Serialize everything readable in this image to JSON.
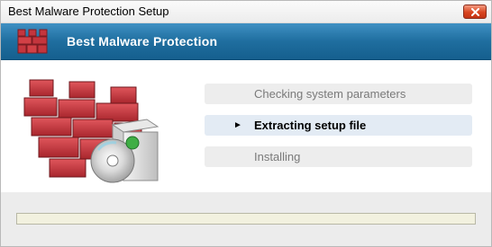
{
  "window": {
    "title": "Best Malware Protection Setup",
    "close_icon": "close-icon"
  },
  "banner": {
    "title": "Best Malware Protection",
    "icon": "brick-wall-icon"
  },
  "hero": {
    "icon": "firewall-installer-icon"
  },
  "steps": [
    {
      "label": "Checking system parameters",
      "state": "done"
    },
    {
      "label": "Extracting setup file",
      "state": "active",
      "marker": "►"
    },
    {
      "label": "Installing",
      "state": "pending"
    }
  ],
  "progress": {
    "fraction": 0
  },
  "colors": {
    "banner": "#1f6e9f",
    "brick": "#c4353d",
    "active_step": "#e3ebf4"
  }
}
